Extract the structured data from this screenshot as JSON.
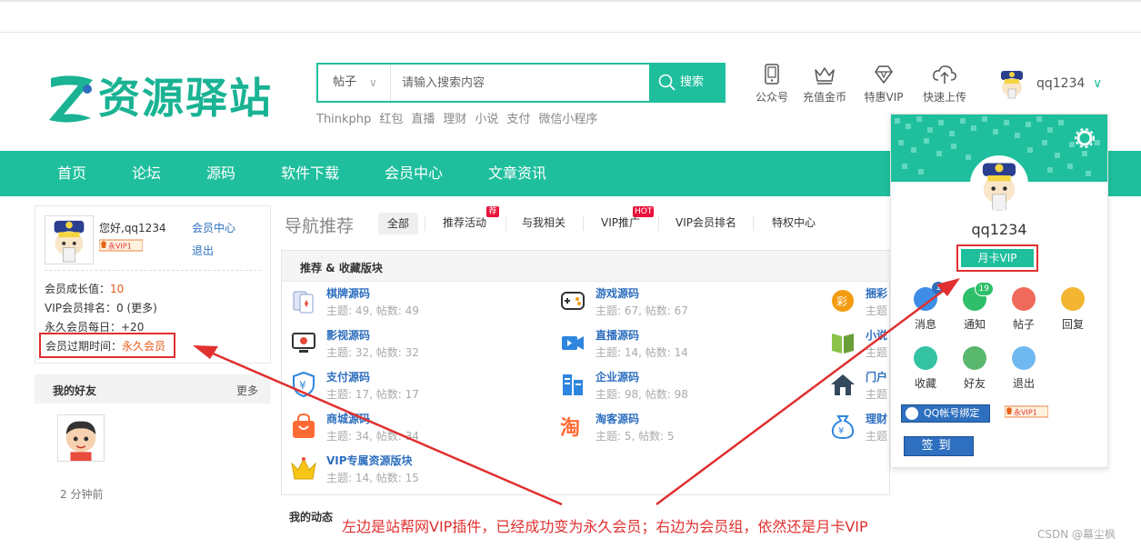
{
  "header": {
    "logo_text": "资源驿站",
    "search": {
      "category": "帖子",
      "placeholder": "请输入搜索内容",
      "button": "搜索"
    },
    "hotwords": [
      "Thinkphp",
      "红包",
      "直播",
      "理财",
      "小说",
      "支付",
      "微信小程序"
    ],
    "tools": [
      {
        "label": "公众号",
        "icon": "phone-icon"
      },
      {
        "label": "充值金币",
        "icon": "crown-icon"
      },
      {
        "label": "特惠VIP",
        "icon": "diamond-icon"
      },
      {
        "label": "快速上传",
        "icon": "cloud-upload-icon"
      }
    ],
    "username": "qq1234"
  },
  "nav": [
    "首页",
    "论坛",
    "源码",
    "软件下载",
    "会员中心",
    "文章资讯"
  ],
  "profile": {
    "greeting": "您好,qq1234",
    "vip_badge": "永VIP1",
    "member_center": "会员中心",
    "logout": "退出",
    "growth_label": "会员成长值：",
    "growth_value": "10",
    "vip_rank_label": "VIP会员排名：0",
    "vip_rank_more": "(更多)",
    "daily_label": "永久会员每日：+20",
    "expiry_label": "会员过期时间：",
    "expiry_value": "永久会员"
  },
  "friends": {
    "title": "我的好友",
    "more": "更多",
    "time": "2 分钟前"
  },
  "nav_rec": {
    "title": "导航推荐",
    "tabs": [
      "全部",
      "推荐活动",
      "与我相关",
      "VIP推广",
      "VIP会员排名",
      "特权中心"
    ],
    "badge_recommend": "荐",
    "badge_hot": "HOT"
  },
  "forum": {
    "title": "推荐 & 收藏版块",
    "items": [
      {
        "name": "棋牌源码",
        "stats": "主题: 49, 帖数: 49"
      },
      {
        "name": "游戏源码",
        "stats": "主题: 67, 帖数: 67"
      },
      {
        "name": "捆彩",
        "stats": "主题"
      },
      {
        "name": "影视源码",
        "stats": "主题: 32, 帖数: 32"
      },
      {
        "name": "直播源码",
        "stats": "主题: 14, 帖数: 14"
      },
      {
        "name": "小说",
        "stats": "主题"
      },
      {
        "name": "支付源码",
        "stats": "主题: 17, 帖数: 17"
      },
      {
        "name": "企业源码",
        "stats": "主题: 98, 帖数: 98"
      },
      {
        "name": "门户",
        "stats": "主题"
      },
      {
        "name": "商城源码",
        "stats": "主题: 34, 帖数: 34"
      },
      {
        "name": "淘客源码",
        "stats": "主题: 5, 帖数: 5"
      },
      {
        "name": "理财",
        "stats": "主题"
      },
      {
        "name": "VIP专属资源版块",
        "stats": "主题: 14, 帖数: 15"
      }
    ]
  },
  "my_dynamic": "我的动态",
  "panel": {
    "username": "qq1234",
    "vip_group": "月卡VIP",
    "icons": [
      {
        "label": "消息",
        "badge": "1",
        "color": "#3d8de6"
      },
      {
        "label": "通知",
        "badge": "19",
        "color": "#2fbf6a"
      },
      {
        "label": "帖子",
        "badge": "",
        "color": "#ef6a5a"
      },
      {
        "label": "回复",
        "badge": "",
        "color": "#f2b632"
      },
      {
        "label": "收藏",
        "badge": "",
        "color": "#33c3a3"
      },
      {
        "label": "好友",
        "badge": "",
        "color": "#59b86e"
      },
      {
        "label": "退出",
        "badge": "",
        "color": "#6fb8f0"
      }
    ],
    "qq_bind": "QQ帐号绑定",
    "vip_badge": "永VIP1",
    "sign": "签到"
  },
  "annotation": "左边是站帮网VIP插件，已经成功变为永久会员；右边为会员组，依然还是月卡VIP",
  "watermark": "CSDN @幕尘枫",
  "colors": {
    "accent": "#1fbf9d",
    "link": "#2e6fbf",
    "highlight": "#e03030"
  }
}
